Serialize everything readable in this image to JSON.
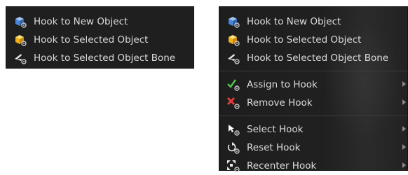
{
  "left_menu": {
    "items": [
      {
        "label": "Hook to New Object",
        "icon": "new-object-hook-icon"
      },
      {
        "label": "Hook to Selected Object",
        "icon": "selected-object-hook-icon"
      },
      {
        "label": "Hook to Selected Object Bone",
        "icon": "bone-hook-icon"
      }
    ]
  },
  "right_menu": {
    "group1": [
      {
        "label": "Hook to New Object",
        "icon": "new-object-hook-icon"
      },
      {
        "label": "Hook to Selected Object",
        "icon": "selected-object-hook-icon"
      },
      {
        "label": "Hook to Selected Object Bone",
        "icon": "bone-hook-icon"
      }
    ],
    "group2": [
      {
        "label": "Assign to Hook",
        "icon": "assign-hook-icon"
      },
      {
        "label": "Remove Hook",
        "icon": "remove-hook-icon"
      }
    ],
    "group3": [
      {
        "label": "Select Hook",
        "icon": "select-hook-icon"
      },
      {
        "label": "Reset Hook",
        "icon": "reset-hook-icon"
      },
      {
        "label": "Recenter Hook",
        "icon": "recenter-hook-icon"
      }
    ]
  },
  "colors": {
    "menu_background": "#1f1f1f",
    "text": "#dcdcdc",
    "submenu_arrow": "#8a8a8a",
    "separator": "#3a3a3a"
  }
}
